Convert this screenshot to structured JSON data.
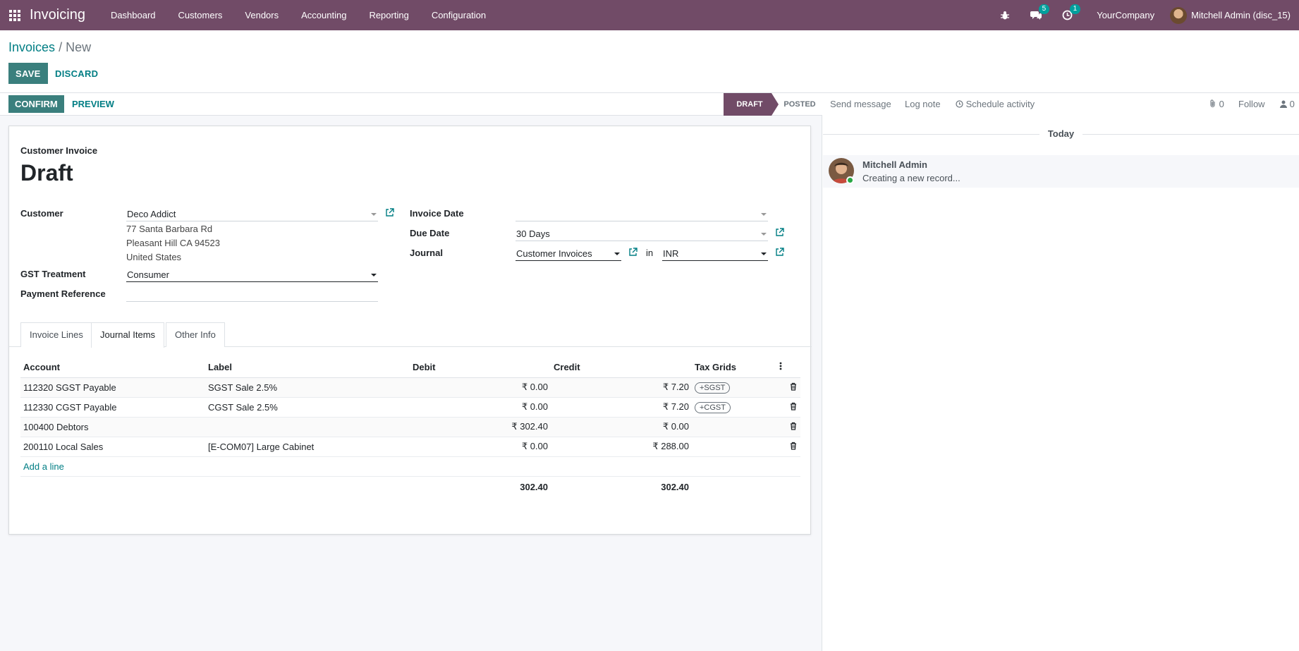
{
  "navbar": {
    "brand": "Invoicing",
    "menu": [
      "Dashboard",
      "Customers",
      "Vendors",
      "Accounting",
      "Reporting",
      "Configuration"
    ],
    "messages_count": "5",
    "activities_count": "1",
    "company": "YourCompany",
    "user": "Mitchell Admin (disc_15)"
  },
  "breadcrumb": {
    "parent": "Invoices",
    "separator": "/",
    "current": "New"
  },
  "actions": {
    "save": "SAVE",
    "discard": "DISCARD",
    "confirm": "CONFIRM",
    "preview": "PREVIEW"
  },
  "status": {
    "draft": "DRAFT",
    "posted": "POSTED",
    "active": "DRAFT"
  },
  "form": {
    "doc_type": "Customer Invoice",
    "doc_name": "Draft",
    "customer_label": "Customer",
    "customer_value": "Deco Addict",
    "address": [
      "77 Santa Barbara Rd",
      "Pleasant Hill CA 94523",
      "United States"
    ],
    "gst_label": "GST Treatment",
    "gst_value": "Consumer",
    "payment_ref_label": "Payment Reference",
    "payment_ref_value": "",
    "invoice_date_label": "Invoice Date",
    "invoice_date_value": "",
    "due_date_label": "Due Date",
    "due_date_value": "30 Days",
    "journal_label": "Journal",
    "journal_value": "Customer Invoices",
    "in_label": "in",
    "currency_value": "INR"
  },
  "tabs": [
    "Invoice Lines",
    "Journal Items",
    "Other Info"
  ],
  "active_tab": "Journal Items",
  "table": {
    "headers": {
      "account": "Account",
      "label": "Label",
      "debit": "Debit",
      "credit": "Credit",
      "tax_grids": "Tax Grids"
    },
    "rows": [
      {
        "account": "112320 SGST Payable",
        "label": "SGST Sale 2.5%",
        "debit": "₹ 0.00",
        "credit": "₹ 7.20",
        "tax": "+SGST"
      },
      {
        "account": "112330 CGST Payable",
        "label": "CGST Sale 2.5%",
        "debit": "₹ 0.00",
        "credit": "₹ 7.20",
        "tax": "+CGST"
      },
      {
        "account": "100400 Debtors",
        "label": "",
        "debit": "₹ 302.40",
        "credit": "₹ 0.00",
        "tax": ""
      },
      {
        "account": "200110 Local Sales",
        "label": "[E-COM07] Large Cabinet",
        "debit": "₹ 0.00",
        "credit": "₹ 288.00",
        "tax": ""
      }
    ],
    "add_line": "Add a line",
    "total_debit": "302.40",
    "total_credit": "302.40"
  },
  "chatter": {
    "send_message": "Send message",
    "log_note": "Log note",
    "schedule_activity": "Schedule activity",
    "attachments_count": "0",
    "follow": "Follow",
    "followers_count": "0",
    "today": "Today",
    "message_author": "Mitchell Admin",
    "message_body": "Creating a new record..."
  },
  "colors": {
    "brand": "#714b67",
    "primary_button": "#3a7f7d",
    "link": "#017e84",
    "badge": "#00a09d"
  }
}
